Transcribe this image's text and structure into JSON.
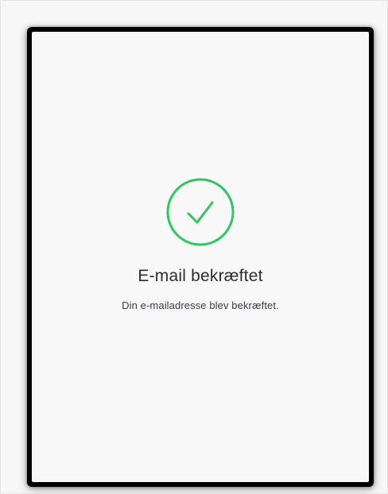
{
  "confirmation": {
    "icon": "check-circle-icon",
    "accent_color": "#2ec95c",
    "title": "E-mail bekræftet",
    "message": "Din e-mailadresse blev bekræftet."
  }
}
